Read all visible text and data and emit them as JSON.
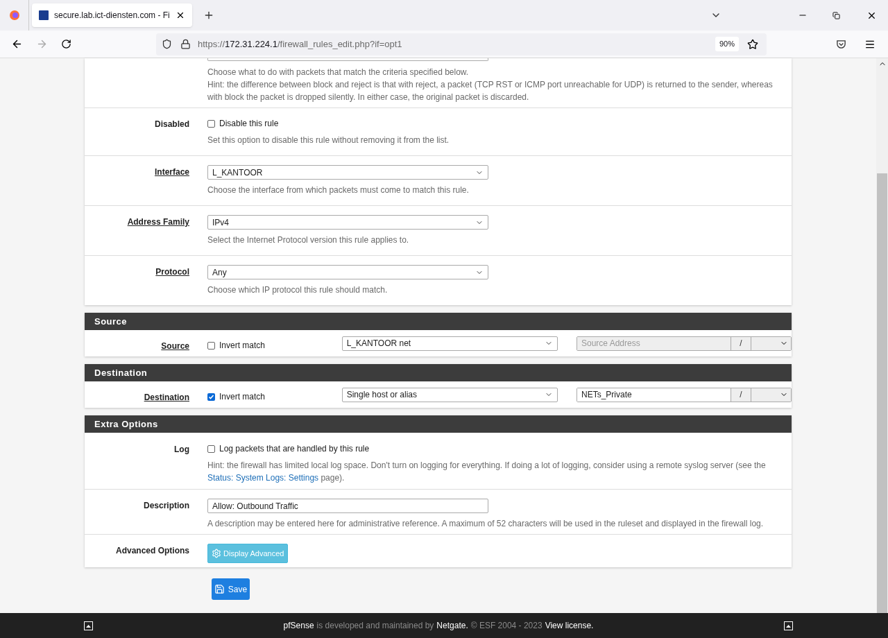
{
  "browser": {
    "tab_title": "secure.lab.ict-diensten.com - Fi",
    "url_scheme": "https://",
    "url_host": "172.31.224.1",
    "url_path": "/firewall_rules_edit.php?if=opt1",
    "zoom": "90%"
  },
  "top_panel": {
    "hints": [
      "Choose what to do with packets that match the criteria specified below.",
      "Hint: the difference between block and reject is that with reject, a packet (TCP RST or ICMP port unreachable for UDP) is returned to the sender, whereas with block the packet is dropped silently. In either case, the original packet is discarded."
    ],
    "rows": [
      {
        "kind": "checkbox",
        "label": "Disabled",
        "underlined": false,
        "option": "Disable this rule",
        "checked": false,
        "help": "Set this option to disable this rule without removing it from the list."
      },
      {
        "kind": "select",
        "label": "Interface",
        "underlined": true,
        "value": "L_KANTOOR",
        "help": "Choose the interface from which packets must come to match this rule."
      },
      {
        "kind": "select",
        "label": "Address Family",
        "underlined": true,
        "value": "IPv4",
        "help": "Select the Internet Protocol version this rule applies to."
      },
      {
        "kind": "select",
        "label": "Protocol",
        "underlined": true,
        "value": "Any",
        "help": "Choose which IP protocol this rule should match."
      }
    ]
  },
  "sections": [
    {
      "title": "Source",
      "label": "Source",
      "invert_label": "Invert match",
      "checked": false,
      "type_value": "L_KANTOOR net",
      "address_placeholder": "Source Address",
      "address_disabled": true,
      "slash": "/"
    },
    {
      "title": "Destination",
      "label": "Destination",
      "invert_label": "Invert match",
      "checked": true,
      "type_value": "Single host or alias",
      "address_value": "NETs_Private",
      "address_disabled": false,
      "slash": "/"
    }
  ],
  "extra": {
    "title": "Extra Options",
    "log": {
      "label": "Log",
      "option": "Log packets that are handled by this rule",
      "checked": false,
      "hint_before": "Hint: the firewall has limited local log space. Don't turn on logging for everything. If doing a lot of logging, consider using a remote syslog server (see the",
      "hint_link": "Status: System Logs: Settings",
      "hint_after": "page)."
    },
    "description": {
      "label": "Description",
      "value": "Allow: Outbound Traffic",
      "help": "A description may be entered here for administrative reference. A maximum of 52 characters will be used in the ruleset and displayed in the firewall log."
    },
    "advanced": {
      "label": "Advanced Options",
      "button": "Display Advanced"
    }
  },
  "save_button": "Save",
  "footer": [
    {
      "kind": "link",
      "text": "pfSense"
    },
    {
      "kind": "text",
      "text": "is developed and maintained by"
    },
    {
      "kind": "link",
      "text": "Netgate."
    },
    {
      "kind": "text",
      "text": "© ESF 2004 - 2023"
    },
    {
      "kind": "link",
      "text": "View license."
    }
  ]
}
